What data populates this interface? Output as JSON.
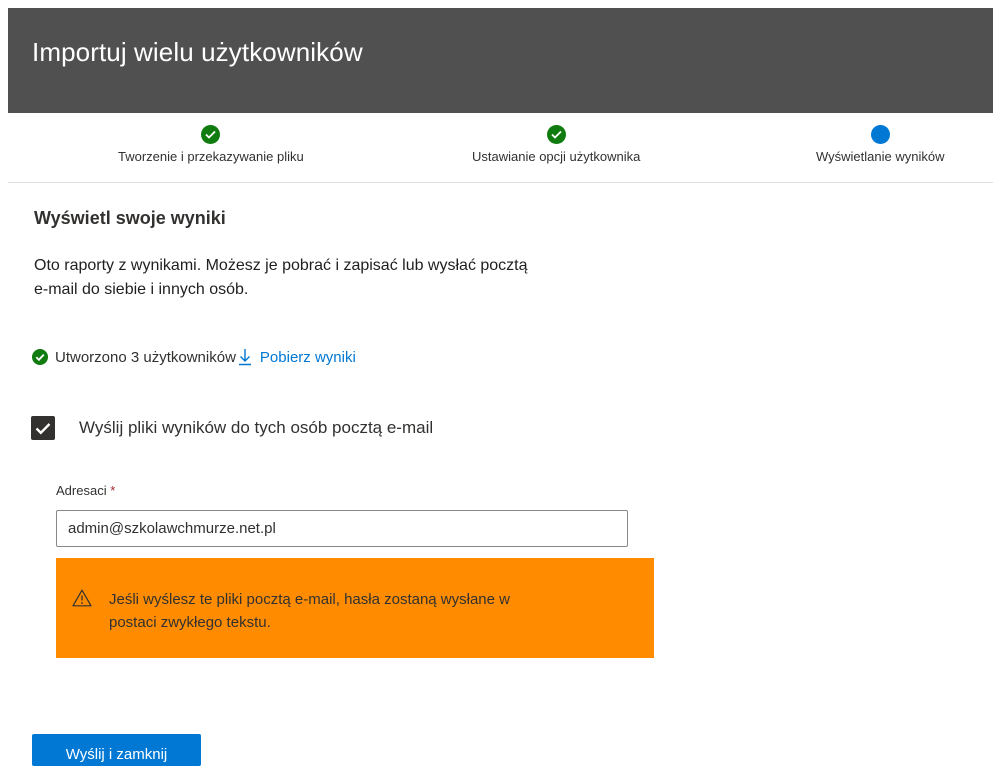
{
  "header": {
    "title": "Importuj wielu użytkowników"
  },
  "stepper": {
    "steps": [
      {
        "label": "Tworzenie i przekazywanie pliku",
        "state": "done"
      },
      {
        "label": "Ustawianie opcji użytkownika",
        "state": "done"
      },
      {
        "label": "Wyświetlanie wyników",
        "state": "current"
      }
    ]
  },
  "main": {
    "title": "Wyświetl swoje wyniki",
    "intro_line1": "Oto raporty z wynikami. Możesz je pobrać i zapisać lub wysłać pocztą",
    "intro_line2": "e-mail do siebie i innych osób.",
    "status_text": "Utworzono 3 użytkowników",
    "download_link": "Pobierz wyniki",
    "send_checkbox": {
      "label": "Wyślij pliki wyników do tych osób pocztą e-mail",
      "checked": true
    },
    "recipients": {
      "label": "Adresaci",
      "required_mark": "*",
      "value": "admin@szkolawchmurze.net.pl"
    },
    "warning": {
      "line1": "Jeśli wyślesz te pliki pocztą e-mail, hasła zostaną wysłane w",
      "line2": "postaci zwykłego tekstu."
    },
    "submit_button": "Wyślij i zamknij"
  },
  "icons": {
    "step_done": "check-circle-icon",
    "step_current": "filled-circle-icon",
    "status": "check-circle-icon",
    "download": "download-arrow-icon",
    "checkbox": "checkmark-icon",
    "warning": "warning-triangle-icon"
  },
  "colors": {
    "header_bg": "#505050",
    "success": "#107c10",
    "accent": "#0078d4",
    "warning_bg": "#ff8c00",
    "required": "#a4262c"
  }
}
